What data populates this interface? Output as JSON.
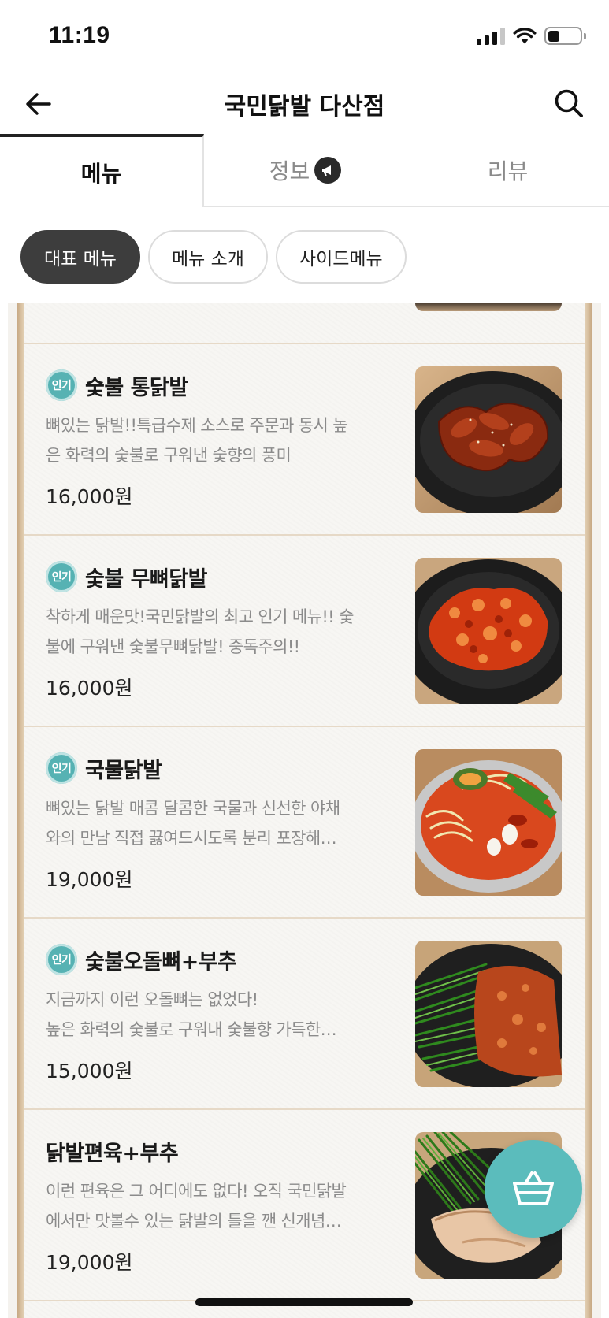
{
  "status_bar": {
    "time": "11:19"
  },
  "header": {
    "title": "국민닭발 다산점"
  },
  "tabs": [
    {
      "label": "메뉴"
    },
    {
      "label": "정보"
    },
    {
      "label": "리뷰"
    }
  ],
  "chips": [
    {
      "label": "대표 메뉴"
    },
    {
      "label": "메뉴 소개"
    },
    {
      "label": "사이드메뉴"
    }
  ],
  "badge_label": "인기",
  "menu_items": [
    {
      "name": "숯불 통닭발",
      "desc_line1": "뼈있는 닭발!!특급수제 소스로 주문과 동시 높",
      "desc_line2": "은 화력의 숯불로 구워낸 숯향의 풍미",
      "price": "16,000원",
      "popular": true
    },
    {
      "name": "숯불 무뼈닭발",
      "desc_line1": "착하게 매운맛!국민닭발의 최고 인기 메뉴!! 숯",
      "desc_line2": "불에 구워낸 숯불무뼈닭발! 중독주의!!",
      "price": "16,000원",
      "popular": true
    },
    {
      "name": "국물닭발",
      "desc_line1": "뼈있는 닭발 매콤 달콤한 국물과 신선한 야채",
      "desc_line2": "와의 만남 직접 끓여드시도록 분리 포장해…",
      "price": "19,000원",
      "popular": true
    },
    {
      "name": "숯불오돌뼈+부추",
      "desc_line1": "지금까지 이런 오돌뼈는 없었다!",
      "desc_line2": "높은 화력의 숯불로 구워내 숯불향 가득한…",
      "price": "15,000원",
      "popular": true
    },
    {
      "name": "닭발편육+부추",
      "desc_line1": "이런 편육은 그 어디에도 없다! 오직 국민닭발",
      "desc_line2": "에서만 맛볼수 있는 닭발의 틀을 깬 신개념…",
      "price": "19,000원",
      "popular": false
    }
  ],
  "icons": {
    "back": "arrow-left-icon",
    "search": "search-icon",
    "info_tab": "megaphone-icon",
    "cart": "basket-icon"
  },
  "colors": {
    "badge": "#56b2b3",
    "cart_button": "#5bbcbc",
    "active_chip": "#3d3d3d"
  }
}
